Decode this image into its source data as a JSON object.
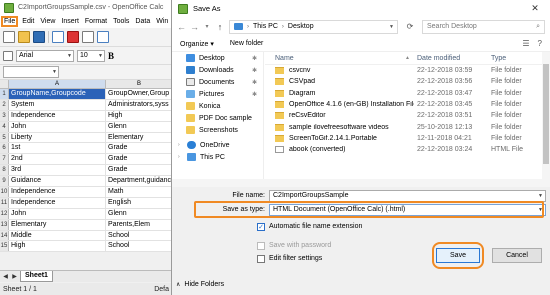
{
  "calc": {
    "title": "C2ImportGroupsSample.csv - OpenOffice Calc",
    "menus": [
      "File",
      "Edit",
      "View",
      "Insert",
      "Format",
      "Tools",
      "Data",
      "Win"
    ],
    "font_name": "Arial",
    "font_size": "10",
    "bold_label": "B",
    "name_box": "",
    "col_a": "A",
    "col_b": "B",
    "rows": [
      {
        "n": "1",
        "a": "GroupName,Groupcode",
        "b": "GroupOwner,Group"
      },
      {
        "n": "2",
        "a": "System",
        "b": "Administrators,syss"
      },
      {
        "n": "3",
        "a": "Independence",
        "b": "High"
      },
      {
        "n": "4",
        "a": "John",
        "b": "Glenn"
      },
      {
        "n": "5",
        "a": "Liberty",
        "b": "Elementary"
      },
      {
        "n": "6",
        "a": "1st",
        "b": "Grade"
      },
      {
        "n": "7",
        "a": "2nd",
        "b": "Grade"
      },
      {
        "n": "8",
        "a": "3rd",
        "b": "Grade"
      },
      {
        "n": "9",
        "a": "Guidance",
        "b": "Department,guidanc"
      },
      {
        "n": "10",
        "a": "Independence",
        "b": "Math"
      },
      {
        "n": "11",
        "a": "Independence",
        "b": "English"
      },
      {
        "n": "12",
        "a": "John",
        "b": "Glenn"
      },
      {
        "n": "13",
        "a": "Elementary",
        "b": "Parents,Elem"
      },
      {
        "n": "14",
        "a": "Middle",
        "b": "School"
      },
      {
        "n": "15",
        "a": "High",
        "b": "School"
      }
    ],
    "sheet_tab": "Sheet1",
    "status_left": "Sheet 1 / 1",
    "status_right": "Defa"
  },
  "dialog": {
    "title": "Save As",
    "close": "✕",
    "breadcrumb": [
      "This PC",
      "Desktop"
    ],
    "search_placeholder": "Search Desktop",
    "organize": "Organize ▾",
    "new_folder": "New folder",
    "nav_items": [
      {
        "label": "Desktop",
        "icon": "desktop-icon",
        "cls": "n-desk",
        "pin": true
      },
      {
        "label": "Downloads",
        "icon": "downloads-icon",
        "cls": "n-down",
        "pin": true
      },
      {
        "label": "Documents",
        "icon": "documents-icon",
        "cls": "n-doc",
        "pin": true
      },
      {
        "label": "Pictures",
        "icon": "pictures-icon",
        "cls": "n-pic",
        "pin": true
      },
      {
        "label": "Konica",
        "icon": "folder-icon",
        "cls": "n-fold",
        "pin": false
      },
      {
        "label": "PDF Doc sample",
        "icon": "folder-icon",
        "cls": "n-fold",
        "pin": false
      },
      {
        "label": "Screenshots",
        "icon": "folder-icon",
        "cls": "n-fold",
        "pin": false
      },
      {
        "label": "OneDrive",
        "icon": "onedrive-icon",
        "cls": "n-od",
        "pin": false,
        "top": true
      },
      {
        "label": "This PC",
        "icon": "computer-icon",
        "cls": "n-pc",
        "pin": false,
        "top": true
      }
    ],
    "columns": {
      "name": "Name",
      "date": "Date modified",
      "type": "Type"
    },
    "files": [
      {
        "name": "csvcnv",
        "date": "22-12-2018 03:59",
        "type": "File folder",
        "kind": "folder"
      },
      {
        "name": "CSVpad",
        "date": "22-12-2018 03:56",
        "type": "File folder",
        "kind": "folder"
      },
      {
        "name": "Diagram",
        "date": "22-12-2018 03:47",
        "type": "File folder",
        "kind": "folder"
      },
      {
        "name": "OpenOffice 4.1.6 (en-GB) Installation Files",
        "date": "22-12-2018 03:45",
        "type": "File folder",
        "kind": "folder"
      },
      {
        "name": "reCsvEditor",
        "date": "22-12-2018 03:51",
        "type": "File folder",
        "kind": "folder"
      },
      {
        "name": "sample ilovefreesoftware videos",
        "date": "25-10-2018 12:13",
        "type": "File folder",
        "kind": "folder"
      },
      {
        "name": "ScreenToGif.2.14.1.Portable",
        "date": "12-11-2018 04:21",
        "type": "File folder",
        "kind": "folder"
      },
      {
        "name": "abook (converted)",
        "date": "22-12-2018 03:24",
        "type": "HTML File",
        "kind": "html"
      }
    ],
    "file_name_label": "File name:",
    "file_name_value": "C2ImportGroupsSample",
    "save_type_label": "Save as type:",
    "save_type_value": "HTML Document (OpenOffice Calc) (.html)",
    "auto_ext": "Automatic file name extension",
    "save_pwd": "Save with password",
    "edit_filter": "Edit filter settings",
    "hide_folders": "Hide Folders",
    "save_btn": "Save",
    "cancel_btn": "Cancel"
  }
}
